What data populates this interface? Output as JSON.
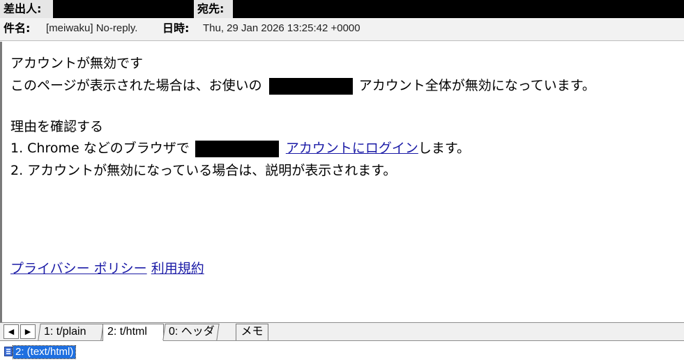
{
  "header": {
    "from_label": "差出人:",
    "to_label": "宛先:",
    "subject_label": "件名:",
    "subject_value": "[meiwaku] No-reply.",
    "date_label": "日時:",
    "date_value": "Thu, 29 Jan 2026 13:25:42 +0000"
  },
  "message": {
    "line1": "アカウントが無効です",
    "line2_a": "このページが表示された場合は、お使いの",
    "line2_b": "アカウント全体が無効になっています。",
    "line3": "理由を確認する",
    "line4_a": "1. Chrome などのブラウザで",
    "line4_link": "アカウントにログイン",
    "line4_b": "します。",
    "line5": "2. アカウントが無効になっている場合は、説明が表示されます。",
    "privacy_link": "プライバシー ポリシー",
    "terms_link": "利用規約"
  },
  "tabs": {
    "prev_icon": "◀",
    "next_icon": "▶",
    "items": [
      "1: t/plain",
      "2: t/html",
      "0: ヘッダ"
    ],
    "memo": "メモ",
    "active_index": 1
  },
  "status": {
    "part_label": "2: (text/html)"
  },
  "colors": {
    "link": "#1a1aa6",
    "selection": "#1e6fe0",
    "redaction": "#000000"
  }
}
